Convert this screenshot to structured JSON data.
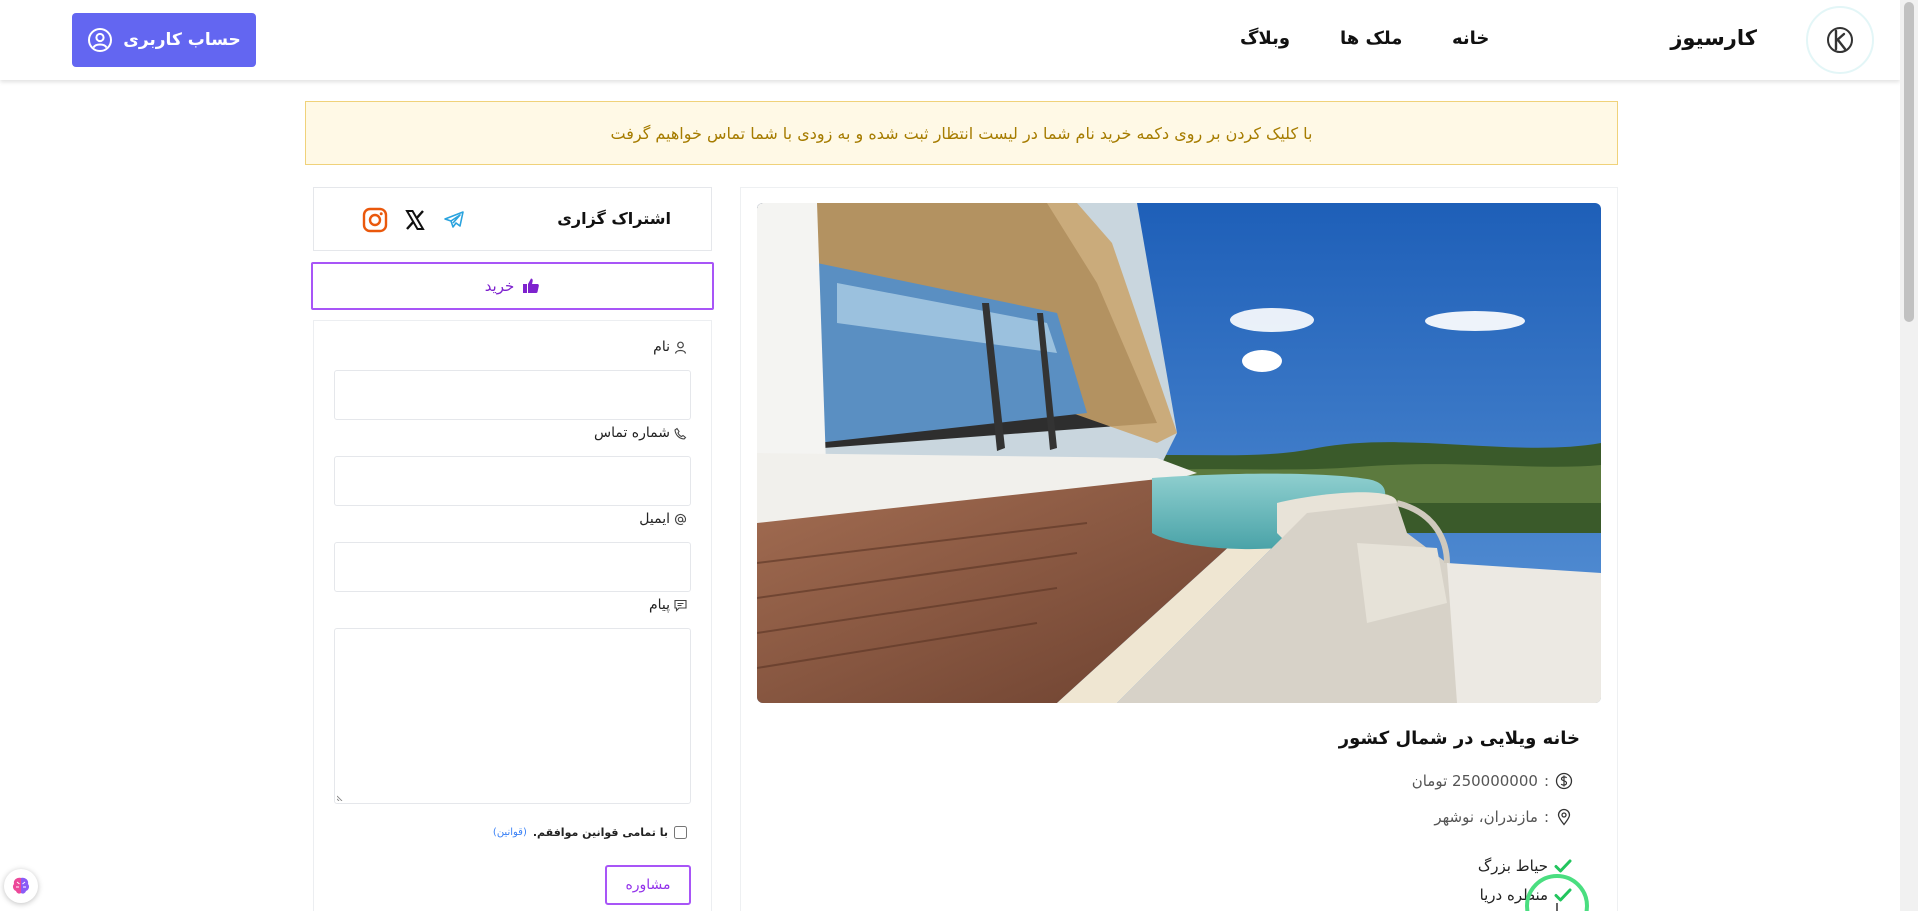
{
  "header": {
    "brand": "کارسیوز",
    "nav": [
      {
        "label": "خانه"
      },
      {
        "label": "ملک ها"
      },
      {
        "label": "وبلاگ"
      }
    ],
    "account_label": "حساب کاربری"
  },
  "alert": {
    "text": "با کلیک کردن بر روی دکمه خرید نام شما در لیست انتظار ثبت شده و به زودی با شما تماس خواهیم گرفت"
  },
  "share": {
    "label": "اشتراک گزاری",
    "icons": [
      "telegram-icon",
      "x-icon",
      "instagram-icon"
    ]
  },
  "buy_label": "خرید",
  "form": {
    "name_label": "نام",
    "phone_label": "شماره تماس",
    "email_label": "ایمیل",
    "message_label": "پیام",
    "agree_text": "با تمامی قوانین موافقم.",
    "rules_link": "(قوانین)",
    "consult_label": "مشاوره"
  },
  "property": {
    "title": "خانه ویلایی در شمال کشور",
    "price": "250000000 تومان",
    "location": "مازندران، نوشهر",
    "features": [
      "حیاط بزرگ",
      "منظره دریا"
    ]
  },
  "colors": {
    "primary": "#6366f1",
    "accent_purple": "#a855f7",
    "alert_bg": "#fff9e6",
    "alert_text": "#a67c00",
    "check_green": "#22c55e"
  }
}
